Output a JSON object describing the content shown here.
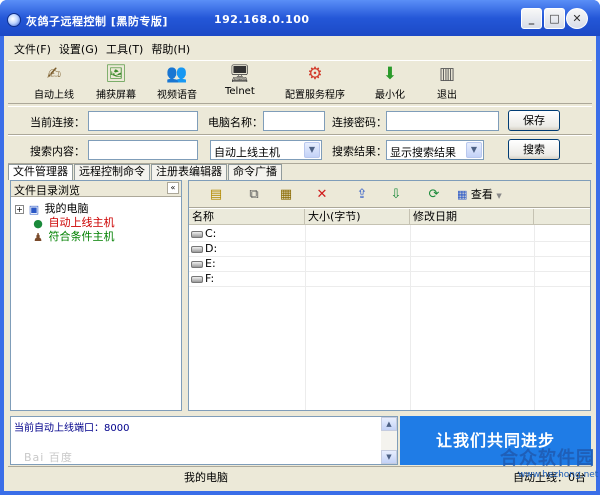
{
  "titlebar": {
    "title": "灰鸽子远程控制 [黑防专版]",
    "ip": "192.168.0.100",
    "min_glyph": "_",
    "max_glyph": "□",
    "close_glyph": "✕"
  },
  "menu": [
    "文件(F)",
    "设置(G)",
    "工具(T)",
    "帮助(H)"
  ],
  "toolbar": [
    {
      "label": "自动上线",
      "icon": "auto-online-icon",
      "glyph": "✍"
    },
    {
      "label": "捕获屏幕",
      "icon": "capture-screen-icon",
      "glyph": "🖼"
    },
    {
      "label": "视频语音",
      "icon": "video-voice-icon",
      "glyph": "👥"
    },
    {
      "label": "Telnet",
      "icon": "telnet-icon",
      "glyph": "🖥"
    },
    {
      "label": "配置服务程序",
      "icon": "config-service-icon",
      "glyph": "⚙"
    },
    {
      "label": "最小化",
      "icon": "minimize-icon",
      "glyph": "⬇"
    },
    {
      "label": "退出",
      "icon": "exit-icon",
      "glyph": "▥"
    }
  ],
  "connection": {
    "current_label": "当前连接：",
    "current_value": "",
    "computer_name_label": "电脑名称：",
    "computer_name_value": "",
    "password_label": "连接密码：",
    "password_value": "",
    "save_label": "保存"
  },
  "search": {
    "content_label": "搜索内容：",
    "content_value": "",
    "scope_value": "自动上线主机",
    "result_label": "搜索结果：",
    "result_value": "显示搜索结果",
    "search_label": "搜索"
  },
  "tabs": [
    "文件管理器",
    "远程控制命令",
    "注册表编辑器",
    "命令广播"
  ],
  "tree": {
    "header": "文件目录浏览",
    "collapse_glyph": "«",
    "expander": "+",
    "nodes": [
      {
        "label": "我的电脑",
        "color": "#000000"
      },
      {
        "label": "自动上线主机",
        "color": "#cc0000"
      },
      {
        "label": "符合条件主机",
        "color": "#008000"
      }
    ]
  },
  "files": {
    "view_label": "查看",
    "columns": [
      "名称",
      "大小(字节)",
      "修改日期"
    ],
    "rows": [
      "C:",
      "D:",
      "E:",
      "F:"
    ]
  },
  "log": {
    "label": "当前自动上线端口：",
    "port": "8000"
  },
  "banner": "让我们共同进步",
  "status": {
    "left": "我的电脑",
    "right": "自动上线：0台"
  },
  "watermark": "Bai 百度",
  "site": {
    "name": "合众软件园",
    "url": "www.hezhong.net"
  }
}
